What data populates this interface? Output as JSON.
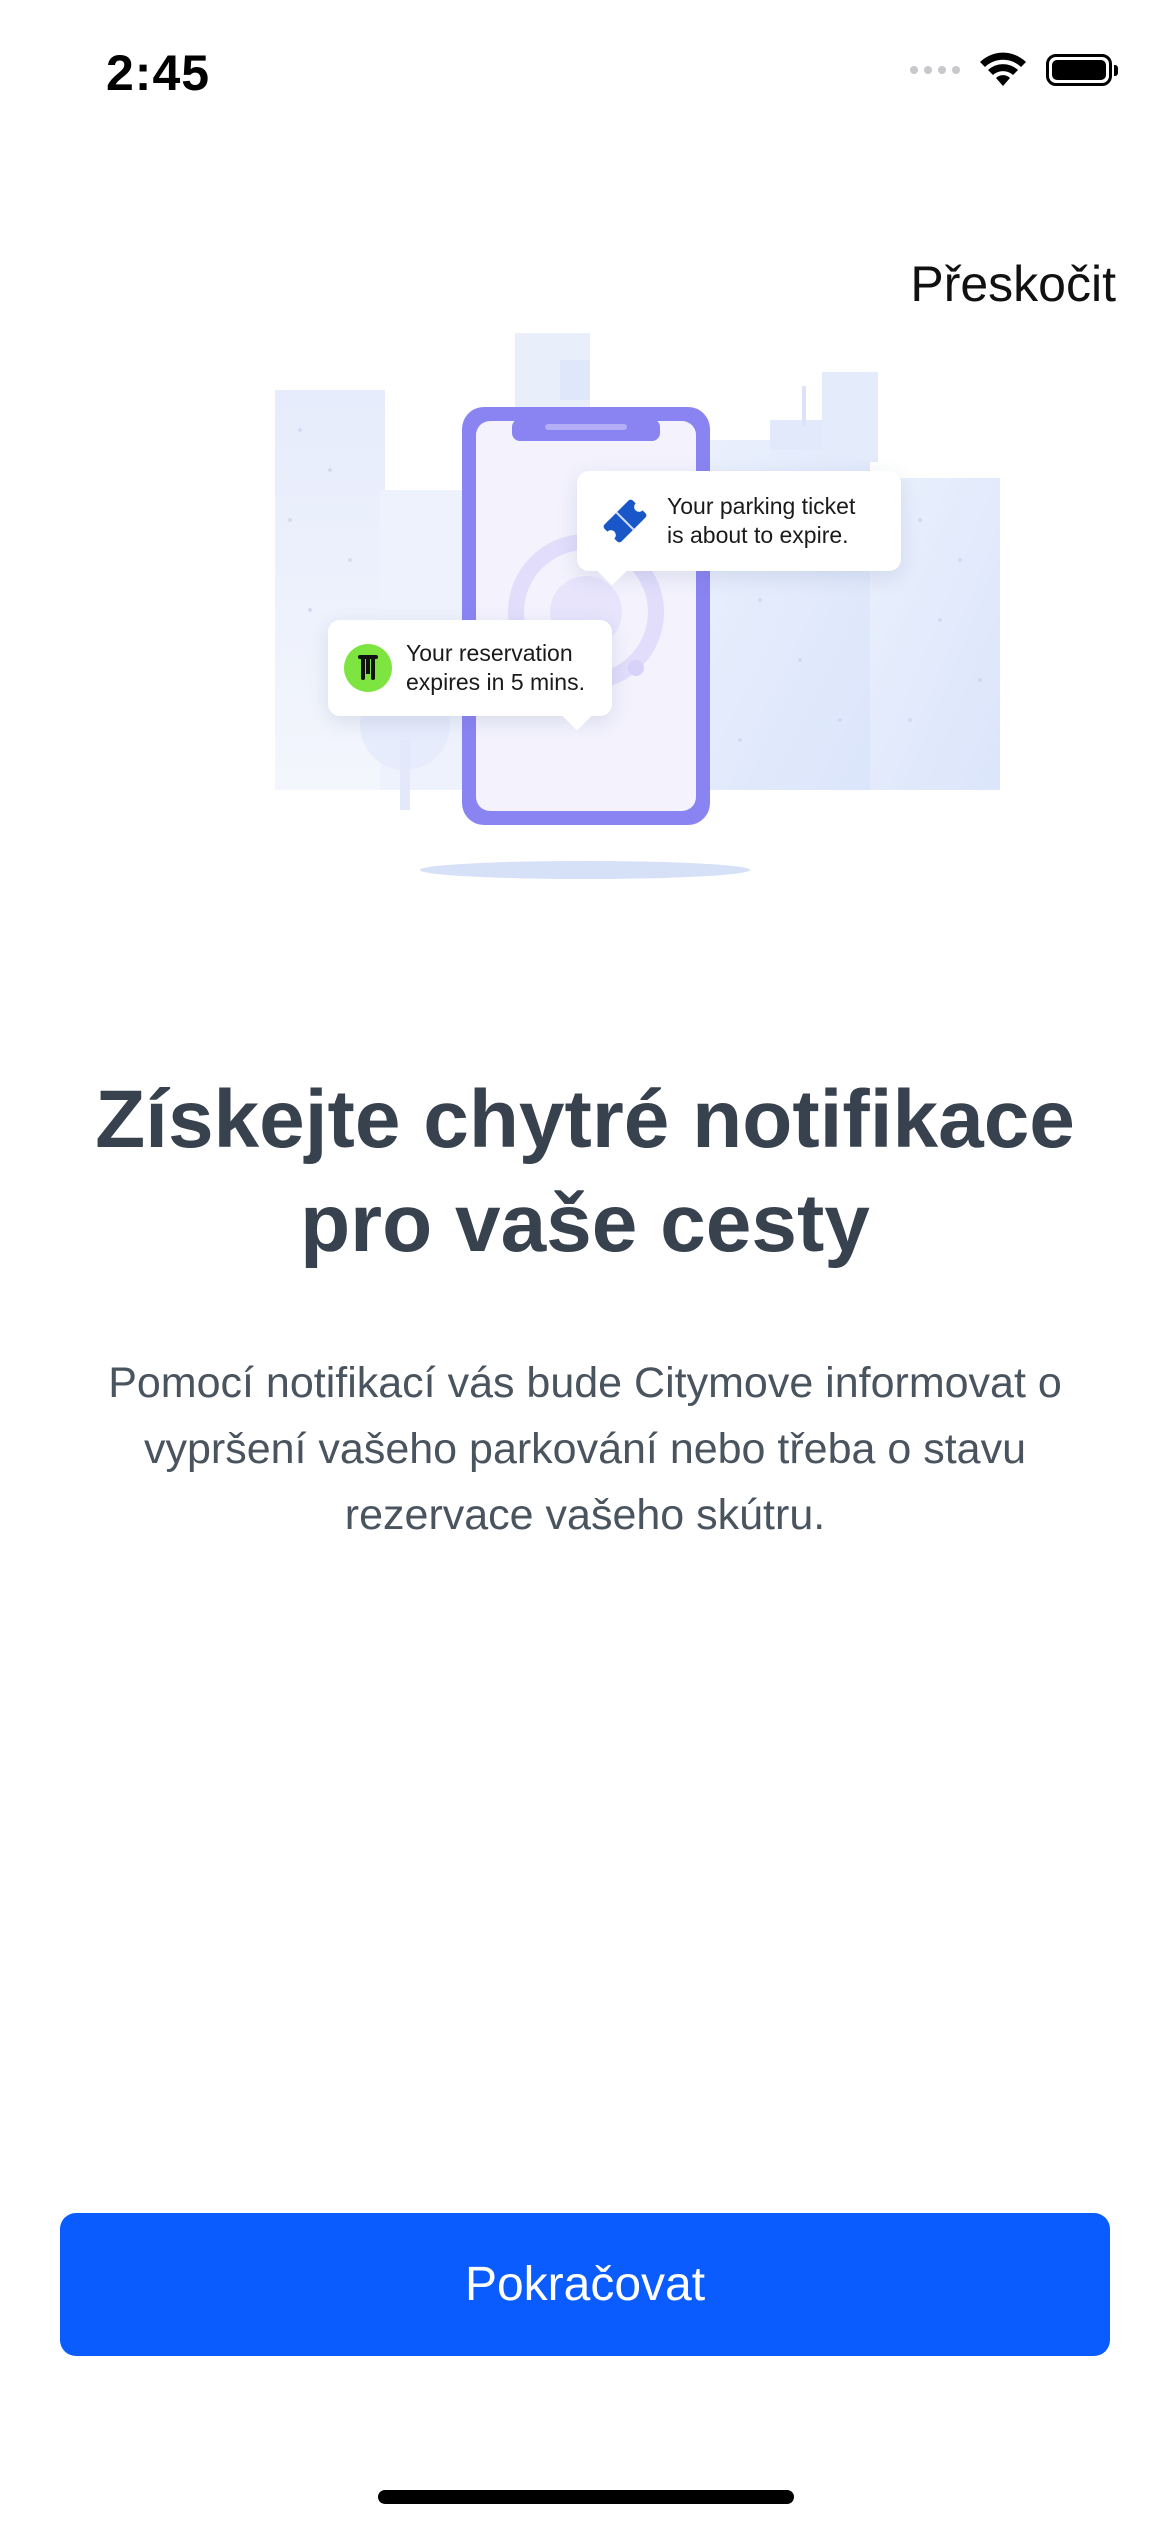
{
  "status_bar": {
    "time": "2:45",
    "icons": [
      "cellular-signal-icon",
      "wifi-icon",
      "battery-icon"
    ]
  },
  "skip": {
    "label": "Přeskočit"
  },
  "illustration": {
    "notifications": [
      {
        "icon": "parking-ticket-icon",
        "line1": "Your parking ticket",
        "line2": "is about to expire."
      },
      {
        "icon": "scooter-icon",
        "line1": "Your reservation",
        "line2": "expires in 5 mins."
      }
    ]
  },
  "content": {
    "title_line1": "Získejte chytré notifikace",
    "title_line2": "pro vaše cesty",
    "description_line1": "Pomocí notifikací vás bude Citymove informovat o",
    "description_line2": "vypršení vašeho parkování nebo třeba o stavu",
    "description_line3": "rezervace vašeho skútru."
  },
  "actions": {
    "continue_label": "Pokračovat"
  },
  "colors": {
    "primary": "#0a5cff",
    "title": "#37424e",
    "body": "#4a545f",
    "phone_frame": "#8a84f2",
    "ticket_blue": "#1957c9",
    "scooter_green": "#7ee43f"
  }
}
